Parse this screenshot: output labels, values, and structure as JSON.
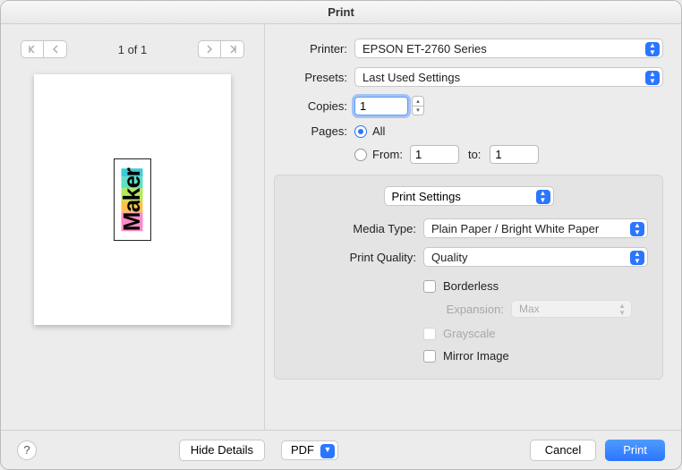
{
  "title": "Print",
  "preview": {
    "page_indicator": "1 of 1",
    "art_text": "Maker"
  },
  "form": {
    "printer_label": "Printer:",
    "printer_value": "EPSON ET-2760 Series",
    "presets_label": "Presets:",
    "presets_value": "Last Used Settings",
    "copies_label": "Copies:",
    "copies_value": "1",
    "pages_label": "Pages:",
    "pages_all": "All",
    "pages_from": "From:",
    "pages_from_value": "1",
    "pages_to": "to:",
    "pages_to_value": "1"
  },
  "settings": {
    "section_value": "Print Settings",
    "media_type_label": "Media Type:",
    "media_type_value": "Plain Paper / Bright White Paper",
    "print_quality_label": "Print Quality:",
    "print_quality_value": "Quality",
    "borderless_label": "Borderless",
    "expansion_label": "Expansion:",
    "expansion_value": "Max",
    "grayscale_label": "Grayscale",
    "mirror_label": "Mirror Image"
  },
  "footer": {
    "help": "?",
    "hide_details": "Hide Details",
    "pdf": "PDF",
    "cancel": "Cancel",
    "print": "Print"
  }
}
